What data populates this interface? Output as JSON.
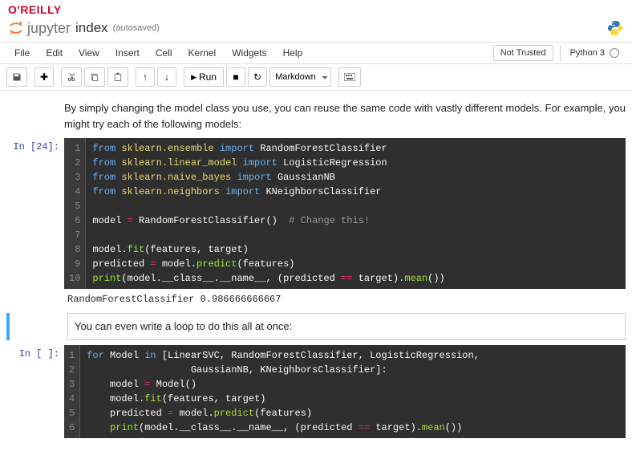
{
  "brand": "O'REILLY",
  "logo_text": "jupyter",
  "notebook_name": "index",
  "autosave": "(autosaved)",
  "menu": {
    "file": "File",
    "edit": "Edit",
    "view": "View",
    "insert": "Insert",
    "cell": "Cell",
    "kernel": "Kernel",
    "widgets": "Widgets",
    "help": "Help"
  },
  "trusted": "Not Trusted",
  "kernel": "Python 3",
  "toolbar": {
    "run": "Run",
    "cell_type": "Markdown"
  },
  "cells": {
    "md1": "By simply changing the model class you use, you can reuse the same code with vastly different models. For example, you might try each of the following models:",
    "c1_prompt": "In [24]:",
    "c1_lines": {
      "ln1_a": "from ",
      "ln1_b": "sklearn.ensemble ",
      "ln1_c": "import ",
      "ln1_d": "RandomForestClassifier",
      "ln2_a": "from ",
      "ln2_b": "sklearn.linear_model ",
      "ln2_c": "import ",
      "ln2_d": "LogisticRegression",
      "ln3_a": "from ",
      "ln3_b": "sklearn.naive_bayes ",
      "ln3_c": "import ",
      "ln3_d": "GaussianNB",
      "ln4_a": "from ",
      "ln4_b": "sklearn.neighbors ",
      "ln4_c": "import ",
      "ln4_d": "KNeighborsClassifier",
      "ln6_a": "model ",
      "ln6_b": "= ",
      "ln6_c": "RandomForestClassifier",
      "ln6_d": "()  ",
      "ln6_e": "# Change this!",
      "ln8_a": "model.",
      "ln8_b": "fit",
      "ln8_c": "(features, target)",
      "ln9_a": "predicted ",
      "ln9_b": "= ",
      "ln9_c": "model.",
      "ln9_d": "predict",
      "ln9_e": "(features)",
      "ln10_a": "print",
      "ln10_b": "(model.",
      "ln10_c": "__class__",
      "ln10_d": ".",
      "ln10_e": "__name__",
      "ln10_f": ", (predicted ",
      "ln10_g": "== ",
      "ln10_h": "target).",
      "ln10_i": "mean",
      "ln10_j": "())"
    },
    "c1_output": "RandomForestClassifier 0.986666666667",
    "md2": "You can even write a loop to do this all at once:",
    "c2_prompt": "In [ ]:",
    "c2_lines": {
      "ln1_a": "for ",
      "ln1_b": "Model ",
      "ln1_c": "in ",
      "ln1_d": "[LinearSVC, RandomForestClassifier, LogisticRegression,",
      "ln2_a": "                  GaussianNB, KNeighborsClassifier]:",
      "ln3_a": "    model ",
      "ln3_b": "= ",
      "ln3_c": "Model()",
      "ln4_a": "    model.",
      "ln4_b": "fit",
      "ln4_c": "(features, target)",
      "ln5_a": "    predicted ",
      "ln5_b": "= ",
      "ln5_c": "model.",
      "ln5_d": "predict",
      "ln5_e": "(features)",
      "ln6_a": "    ",
      "ln6_b": "print",
      "ln6_c": "(model.",
      "ln6_d": "__class__",
      "ln6_e": ".",
      "ln6_f": "__name__",
      "ln6_g": ", (predicted ",
      "ln6_h": "== ",
      "ln6_i": "target).",
      "ln6_j": "mean",
      "ln6_k": "())"
    }
  }
}
